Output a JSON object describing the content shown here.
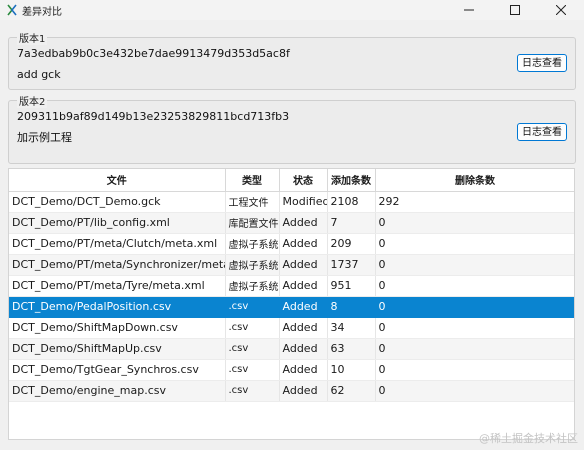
{
  "window": {
    "title": "差异对比"
  },
  "version1": {
    "legend": "版本1",
    "hash": "7a3edbab9b0c3e432be7dae9913479d353d5ac8f",
    "message": "add gck",
    "log_button": "日志查看"
  },
  "version2": {
    "legend": "版本2",
    "hash": "209311b9af89d149b13e23253829811bcd713fb3",
    "message": "加示例工程",
    "log_button": "日志查看"
  },
  "table": {
    "columns": [
      "文件",
      "类型",
      "状态",
      "添加条数",
      "删除条数"
    ],
    "rows": [
      {
        "file": "DCT_Demo/DCT_Demo.gck",
        "type": "工程文件",
        "status": "Modified",
        "added": "2108",
        "deleted": "292"
      },
      {
        "file": "DCT_Demo/PT/lib_config.xml",
        "type": "库配置文件",
        "status": "Added",
        "added": "7",
        "deleted": "0"
      },
      {
        "file": "DCT_Demo/PT/meta/Clutch/meta.xml",
        "type": "虚拟子系统",
        "status": "Added",
        "added": "209",
        "deleted": "0"
      },
      {
        "file": "DCT_Demo/PT/meta/Synchronizer/meta.xml",
        "type": "虚拟子系统",
        "status": "Added",
        "added": "1737",
        "deleted": "0"
      },
      {
        "file": "DCT_Demo/PT/meta/Tyre/meta.xml",
        "type": "虚拟子系统",
        "status": "Added",
        "added": "951",
        "deleted": "0"
      },
      {
        "file": "DCT_Demo/PedalPosition.csv",
        "type": ".csv",
        "status": "Added",
        "added": "8",
        "deleted": "0"
      },
      {
        "file": "DCT_Demo/ShiftMapDown.csv",
        "type": ".csv",
        "status": "Added",
        "added": "34",
        "deleted": "0"
      },
      {
        "file": "DCT_Demo/ShiftMapUp.csv",
        "type": ".csv",
        "status": "Added",
        "added": "63",
        "deleted": "0"
      },
      {
        "file": "DCT_Demo/TgtGear_Synchros.csv",
        "type": ".csv",
        "status": "Added",
        "added": "10",
        "deleted": "0"
      },
      {
        "file": "DCT_Demo/engine_map.csv",
        "type": ".csv",
        "status": "Added",
        "added": "62",
        "deleted": "0"
      }
    ],
    "selected_index": 5
  },
  "colors": {
    "selection": "#0a84d0",
    "button_border": "#0078d4"
  },
  "icons": {
    "app": "app-icon",
    "minimize": "minimize-icon",
    "maximize": "maximize-icon",
    "close": "close-icon"
  },
  "watermark": "@稀土掘金技术社区"
}
